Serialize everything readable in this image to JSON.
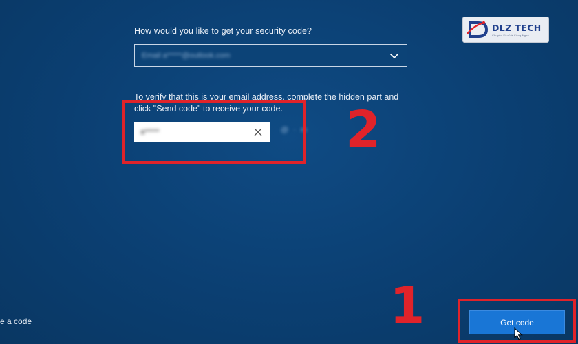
{
  "form": {
    "question": "How would you like to get your security code?",
    "method_select": {
      "value": "Email a*****@outlook.com"
    },
    "instructions": "To verify that this is your email address, complete the hidden part and click \"Send code\" to receive your code.",
    "verify_input": {
      "value": "a*****"
    },
    "suffix_hint": "@  ·  m"
  },
  "footer": {
    "have_code_link": "e a code",
    "get_code_button": "Get code"
  },
  "annotations": {
    "step1": "1",
    "step2": "2",
    "color": "#e0232a"
  },
  "logo": {
    "brand": "DLZ TECH",
    "tagline": "Chuyên Sâu Về Công Nghệ"
  },
  "icons": {
    "dropdown": "chevron-down-icon",
    "clear": "close-icon",
    "pointer": "mouse-cursor-icon",
    "logo": "dlz-logo-icon"
  },
  "colors": {
    "background": "#0b3f72",
    "button": "#1976d6",
    "annotation": "#e0232a"
  }
}
